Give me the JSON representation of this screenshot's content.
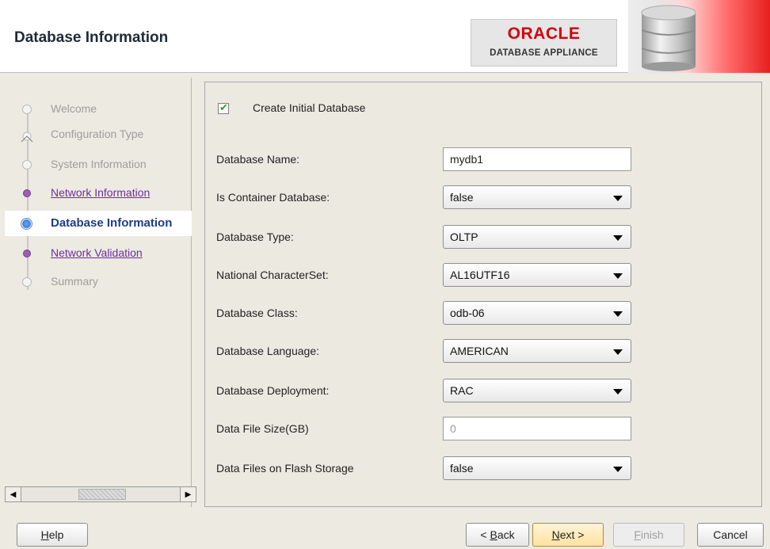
{
  "header": {
    "title": "Database Information",
    "logo_brand": "ORACLE",
    "logo_subtitle": "DATABASE APPLIANCE",
    "brand_color": "#d3000f"
  },
  "nav": {
    "items": [
      {
        "label": "Welcome",
        "state": "inactive"
      },
      {
        "label": "Configuration Type",
        "state": "inactive"
      },
      {
        "label": "System Information",
        "state": "inactive"
      },
      {
        "label": "Network Information",
        "state": "link"
      },
      {
        "label": "Database Information",
        "state": "current"
      },
      {
        "label": "Network Validation",
        "state": "link"
      },
      {
        "label": "Summary",
        "state": "inactive"
      }
    ]
  },
  "form": {
    "create_db_checkbox": {
      "label": "Create Initial Database",
      "checked": true
    },
    "fields": [
      {
        "label": "Database Name:",
        "type": "text",
        "value": "mydb1"
      },
      {
        "label": "Is Container Database:",
        "type": "select",
        "value": "false"
      },
      {
        "label": "Database Type:",
        "type": "select",
        "value": "OLTP"
      },
      {
        "label": "National CharacterSet:",
        "type": "select",
        "value": "AL16UTF16"
      },
      {
        "label": "Database Class:",
        "type": "select",
        "value": "odb-06"
      },
      {
        "label": "Database Language:",
        "type": "select",
        "value": "AMERICAN"
      },
      {
        "label": "Database Deployment:",
        "type": "select",
        "value": "RAC"
      },
      {
        "label": "Data File Size(GB)",
        "type": "text-disabled",
        "value": "0"
      },
      {
        "label": "Data Files on Flash Storage",
        "type": "select",
        "value": "false"
      }
    ]
  },
  "buttons": {
    "help": {
      "pre": "",
      "mnemonic": "H",
      "post": "elp"
    },
    "back": {
      "pre": "< ",
      "mnemonic": "B",
      "post": "ack"
    },
    "next": {
      "pre": "",
      "mnemonic": "N",
      "post": "ext >"
    },
    "finish": {
      "pre": "",
      "mnemonic": "F",
      "post": "inish"
    },
    "cancel": {
      "pre": "Cancel",
      "mnemonic": "",
      "post": ""
    }
  }
}
